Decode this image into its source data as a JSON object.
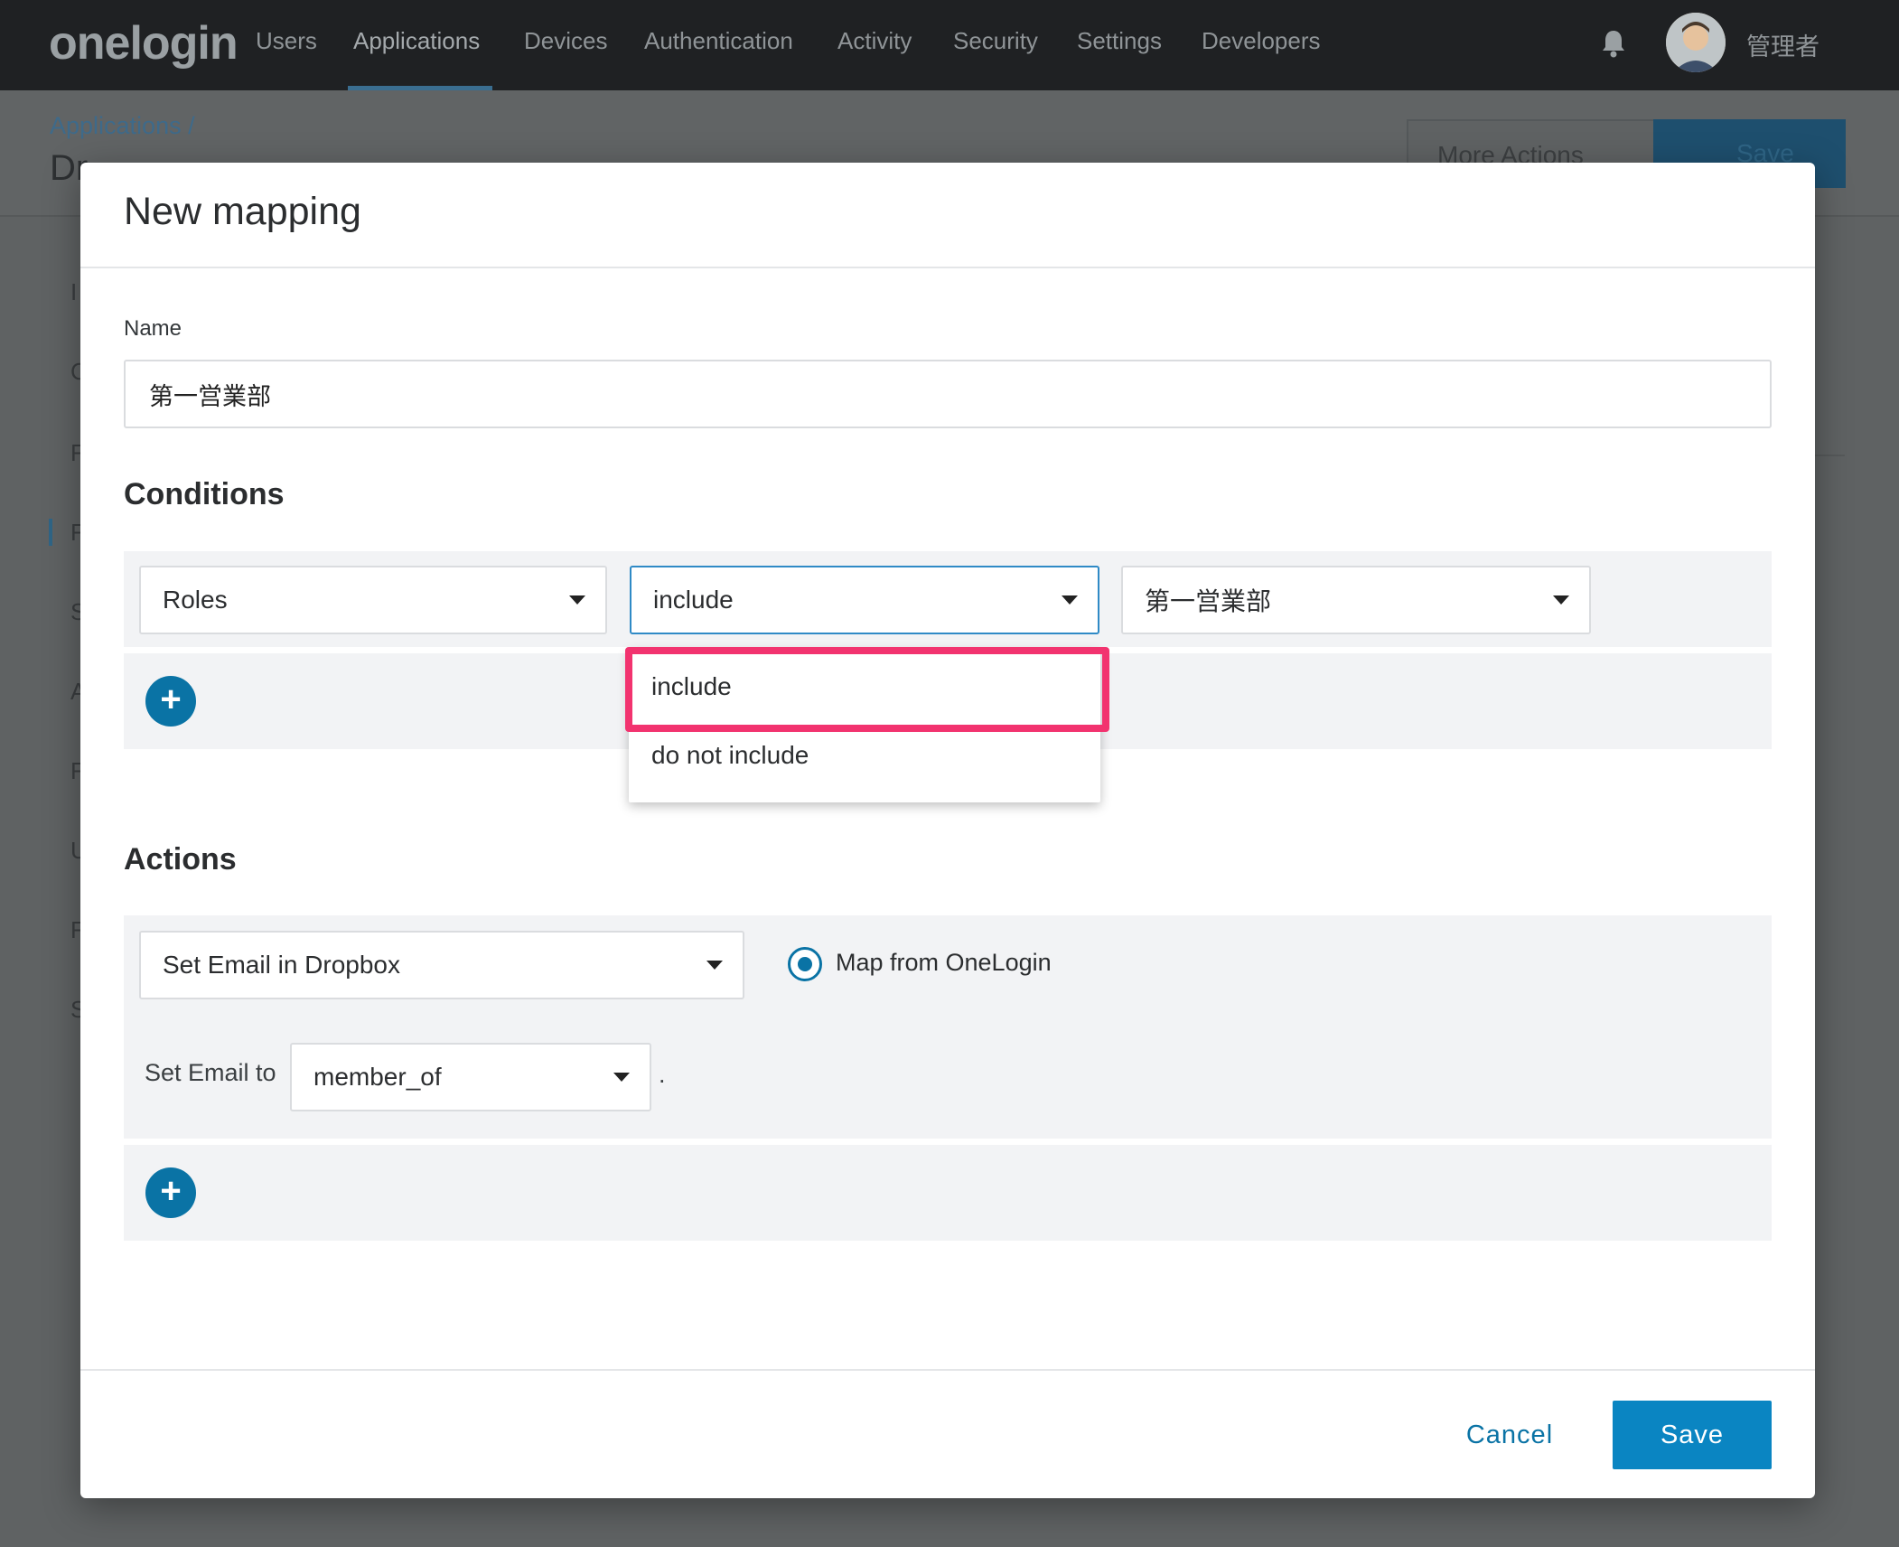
{
  "nav": {
    "logo": "onelogin",
    "items": [
      "Users",
      "Applications",
      "Devices",
      "Authentication",
      "Activity",
      "Security",
      "Settings",
      "Developers"
    ],
    "active_item": "Applications",
    "user_name": "管理者"
  },
  "background_page": {
    "breadcrumb": "Applications /",
    "title_fragment": "Dr",
    "more_actions_label": "More Actions",
    "save_label": "Save",
    "sidebar_fragments": [
      "I",
      "C",
      "F",
      "F",
      "S",
      "A",
      "F",
      "U",
      "F",
      "S"
    ]
  },
  "modal": {
    "title": "New mapping",
    "name_label": "Name",
    "name_value": "第一営業部",
    "conditions_heading": "Conditions",
    "condition": {
      "field": "Roles",
      "operator": "include",
      "value": "第一営業部"
    },
    "operator_options": [
      "include",
      "do not include"
    ],
    "highlighted_option": "include",
    "actions_heading": "Actions",
    "action": {
      "type": "Set Email in Dropbox",
      "radio_label": "Map from OneLogin",
      "radio_selected": true,
      "set_label": "Set Email to",
      "set_value": "member_of",
      "trailing_period": "."
    },
    "add_symbol": "+",
    "cancel_label": "Cancel",
    "save_label": "Save"
  },
  "colors": {
    "accent": "#0a85c2",
    "add_button": "#0a73a5",
    "highlight_border": "#f2336f",
    "nav_bg": "#1f2123"
  }
}
